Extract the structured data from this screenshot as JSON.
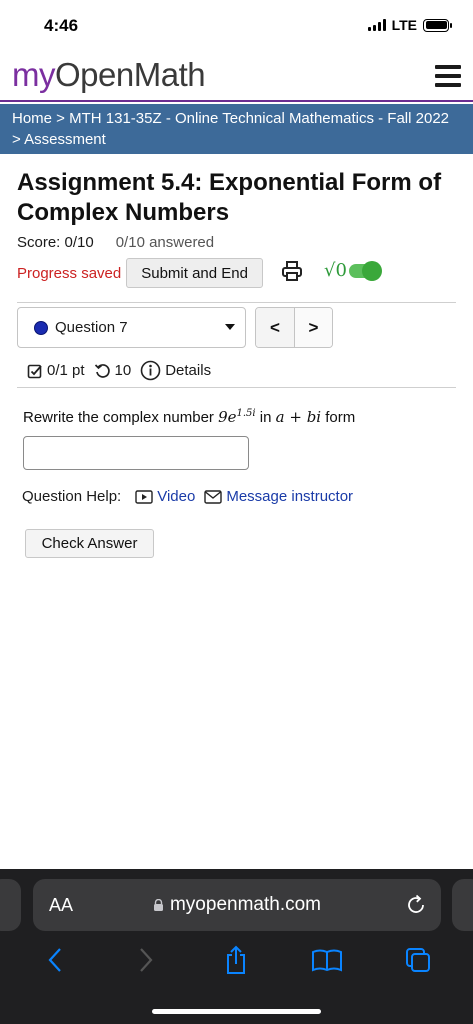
{
  "status_bar": {
    "time": "4:46",
    "network": "LTE"
  },
  "header": {
    "logo_my": "my",
    "logo_openmath": "OpenMath",
    "menu_icon": "hamburger-icon"
  },
  "breadcrumb": {
    "home": "Home",
    "sep1": " > ",
    "course": "MTH 131-35Z - Online Technical Mathematics - Fall 2022",
    "sep2": " > ",
    "page": "Assessment"
  },
  "assignment": {
    "title": "Assignment 5.4: Exponential Form of Complex Numbers",
    "score": "Score: 0/10",
    "answered": "0/10 answered"
  },
  "progress": {
    "status": "Progress saved",
    "submit_label": "Submit and End",
    "print_icon": "printer-icon",
    "mathquill_symbol": "√0",
    "mathquill_enabled": true
  },
  "question_nav": {
    "selected": "Question 7",
    "prev_label": "<",
    "next_label": ">"
  },
  "question_meta": {
    "points": "0/1 pt",
    "attempts": "10",
    "details": "Details"
  },
  "question": {
    "prefix": "Rewrite the complex number ",
    "base": "9e",
    "exponent": "1.5i",
    "mid": " in ",
    "form": "a + bi",
    "suffix": " form",
    "answer_value": ""
  },
  "help": {
    "label": "Question Help:",
    "video": "Video",
    "message": "Message instructor"
  },
  "check_answer_label": "Check Answer",
  "browser": {
    "aa": "AA",
    "url": "myopenmath.com"
  },
  "colors": {
    "brand_purple": "#7b2fa0",
    "breadcrumb_bg": "#3d6a99",
    "progress_red": "#cc2222",
    "link_blue": "#1a3ba8",
    "toggle_green": "#3aa83a"
  }
}
